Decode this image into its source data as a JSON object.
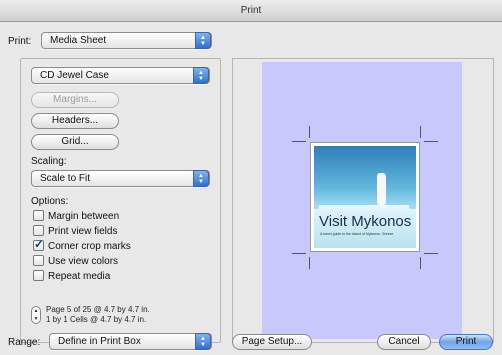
{
  "window": {
    "title": "Print"
  },
  "print_selector": {
    "label": "Print:",
    "value": "Media Sheet"
  },
  "media": {
    "value": "CD Jewel Case"
  },
  "buttons": {
    "margins": "Margins...",
    "headers": "Headers...",
    "grid": "Grid...",
    "page_setup": "Page Setup...",
    "cancel": "Cancel",
    "print": "Print"
  },
  "scaling": {
    "label": "Scaling:",
    "value": "Scale to Fit"
  },
  "options": {
    "label": "Options:",
    "items": [
      {
        "label": "Margin between",
        "checked": false
      },
      {
        "label": "Print view fields",
        "checked": false
      },
      {
        "label": "Corner crop marks",
        "checked": true
      },
      {
        "label": "Use view colors",
        "checked": false
      },
      {
        "label": "Repeat media",
        "checked": false
      }
    ]
  },
  "page_info": {
    "line1": "Page 5 of 25 @ 4.7 by 4.7 in.",
    "line2": "1 by 1 Cells @ 4.7 by 4.7 in."
  },
  "range": {
    "label": "Range:",
    "value": "Define in Print Box"
  },
  "preview": {
    "sheet_color": "#c8c8fc",
    "card_title": "Visit Mykonos",
    "card_subtitle": "A travel guide to the island of Mykonos, Greece"
  },
  "colors": {
    "accent": "#2f6fd3"
  }
}
